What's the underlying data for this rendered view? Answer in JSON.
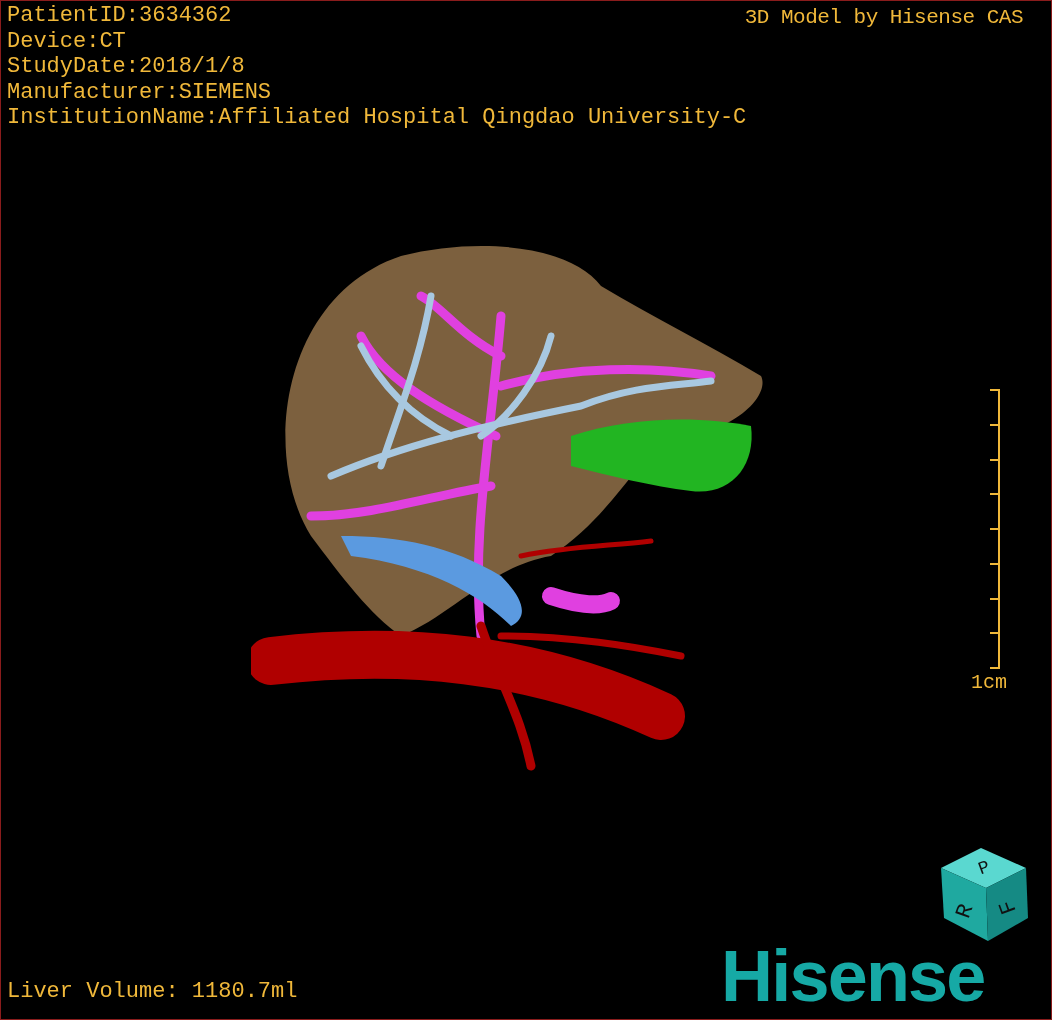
{
  "info_lines": [
    "PatientID:3634362",
    "Device:CT",
    "StudyDate:2018/1/8",
    "Manufacturer:SIEMENS",
    "InstitutionName:Affiliated Hospital Qingdao University-C"
  ],
  "title": "3D Model by Hisense CAS",
  "scale": {
    "label": "1cm"
  },
  "orientation_cube": {
    "faces": [
      "P",
      "R",
      "F"
    ]
  },
  "logo": "Hisense",
  "liver_volume": "Liver Volume: 1180.7ml"
}
